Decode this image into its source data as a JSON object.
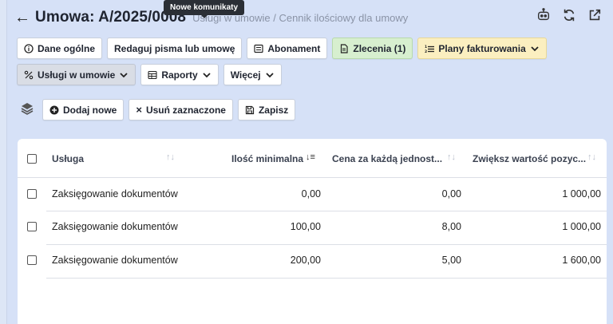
{
  "tooltip": "Nowe komunikaty",
  "header": {
    "title": "Umowa: A/2025/0008",
    "breadcrumb": "Usługi w umowie / Cennik ilościowy dla umowy"
  },
  "buttons_row1": [
    {
      "label": "Dane ogólne",
      "icon": "info-icon"
    },
    {
      "label": "Redaguj pisma lub umowę"
    },
    {
      "label": "Abonament",
      "icon": "list-icon"
    },
    {
      "label": "Zlecenia (1)",
      "icon": "document-icon"
    },
    {
      "label": "Plany fakturowania",
      "icon": "ordered-list-icon"
    }
  ],
  "buttons_row2": [
    {
      "label": "Usługi w umowie",
      "icon": "percent-icon"
    },
    {
      "label": "Raporty",
      "icon": "table-icon"
    },
    {
      "label": "Więcej"
    }
  ],
  "toolbar": {
    "add": "Dodaj nowe",
    "delete": "Usuń zaznaczone",
    "save": "Zapisz"
  },
  "table": {
    "columns": [
      "Usługa",
      "Ilość minimalna",
      "Cena za każdą jednost...",
      "Zwiększ wartość pozyc..."
    ],
    "rows": [
      {
        "service": "Zaksięgowanie dokumentów",
        "min_qty": "0,00",
        "unit_price": "0,00",
        "increase": "1 000,00"
      },
      {
        "service": "Zaksięgowanie dokumentów",
        "min_qty": "100,00",
        "unit_price": "8,00",
        "increase": "1 000,00"
      },
      {
        "service": "Zaksięgowanie dokumentów",
        "min_qty": "200,00",
        "unit_price": "5,00",
        "increase": "1 600,00"
      }
    ]
  },
  "colors": {
    "background": "#d6e1f7",
    "green_button": "#d7efcf",
    "yellow_button": "#fbefc0"
  }
}
